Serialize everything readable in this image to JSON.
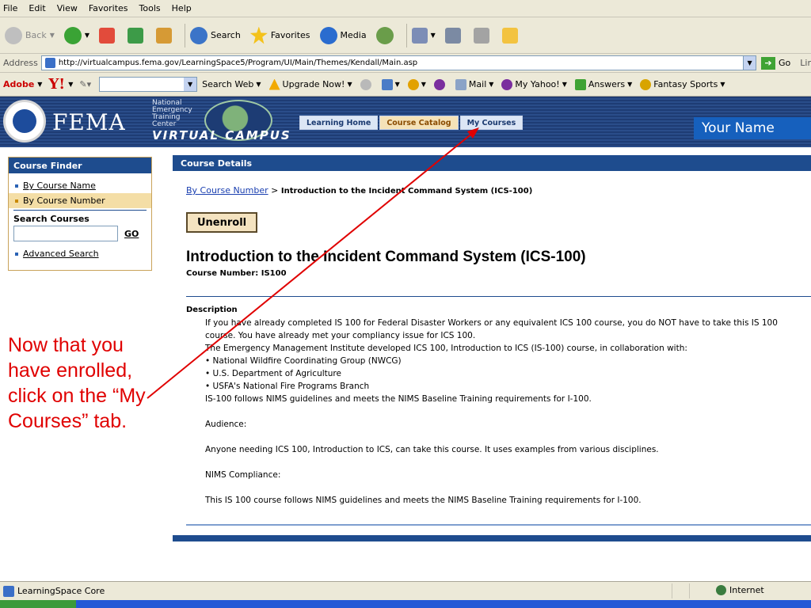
{
  "menubar": {
    "items": [
      "File",
      "Edit",
      "View",
      "Favorites",
      "Tools",
      "Help"
    ]
  },
  "toolbar": {
    "back_label": "Back",
    "search_label": "Search",
    "favorites_label": "Favorites",
    "media_label": "Media"
  },
  "address": {
    "label": "Address",
    "url": "http://virtualcampus.fema.gov/LearningSpace5/Program/UI/Main/Themes/Kendall/Main.asp",
    "go_label": "Go",
    "links_label": "Lir"
  },
  "yahoobar": {
    "adobe_label": "Adobe",
    "yahoo_label": "Y!",
    "search_web_label": "Search Web",
    "upgrade_label": "Upgrade Now!",
    "mail_label": "Mail",
    "my_yahoo_label": "My Yahoo!",
    "answers_label": "Answers",
    "fantasy_label": "Fantasy Sports"
  },
  "header": {
    "logo_text": "FEMA",
    "emi_lines": [
      "National",
      "Emergency",
      "Training",
      "Center"
    ],
    "virtual_campus": "VIRTUAL CAMPUS",
    "tabs": [
      {
        "label": "Learning Home"
      },
      {
        "label": "Course Catalog"
      },
      {
        "label": "My Courses"
      }
    ],
    "user_name": "Your Name"
  },
  "sidebar": {
    "title": "Course Finder",
    "items": [
      {
        "label": "By Course Name"
      },
      {
        "label": "By Course Number"
      }
    ],
    "search_label": "Search Courses",
    "search_value": "",
    "go_label": "GO",
    "advanced_label": "Advanced Search"
  },
  "annotation": {
    "text": "Now that you have enrolled, click on the “My Courses” tab.",
    "color": "#e00000"
  },
  "content": {
    "bar_title": "Course Details",
    "breadcrumb_link": "By Course Number",
    "breadcrumb_sep": " > ",
    "breadcrumb_current": "Introduction to the Incident Command System (ICS-100)",
    "unenroll_label": "Unenroll",
    "course_title": "Introduction to the Incident Command System (ICS-100)",
    "course_number": "Course Number: IS100",
    "description_heading": "Description",
    "description_lines": [
      "If you have already completed IS 100 for Federal Disaster Workers or any equivalent ICS 100 course, you do NOT have to take this IS 100",
      "course. You have already met your compliancy issue for ICS 100.",
      "The Emergency Management Institute developed ICS 100, Introduction to ICS (IS-100) course, in collaboration with:",
      "• National Wildfire Coordinating Group (NWCG)",
      "• U.S. Department of Agriculture",
      "• USFA's National Fire Programs Branch",
      "IS-100 follows NIMS guidelines and meets the NIMS Baseline Training requirements for I-100."
    ],
    "audience_label": "Audience:",
    "audience_text": "Anyone needing ICS 100, Introduction to ICS, can take this course. It uses examples from various disciplines.",
    "nims_label": "NIMS Compliance:",
    "nims_text": "This IS 100 course follows NIMS guidelines and meets the NIMS Baseline Training requirements for I-100."
  },
  "statusbar": {
    "text": "LearningSpace Core",
    "zone": "Internet"
  }
}
